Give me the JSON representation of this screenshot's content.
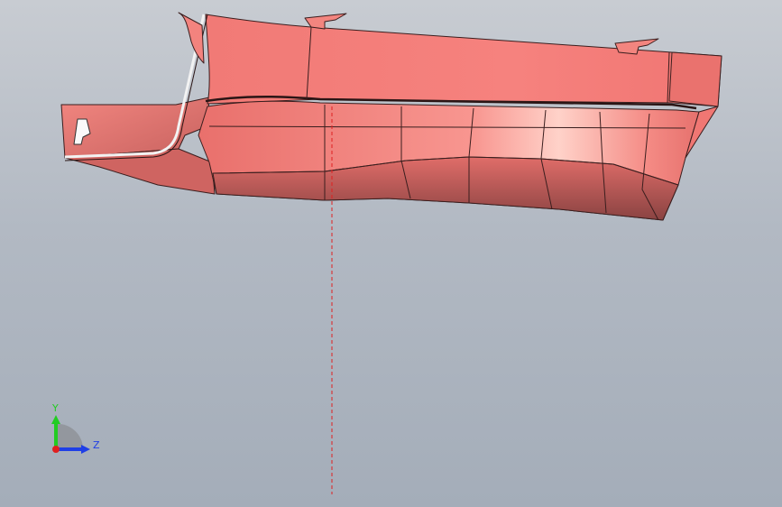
{
  "viewport": {
    "background_top": "#c8ccd2",
    "background_bottom": "#a4adb9",
    "model": {
      "name": "molded-part",
      "face_color": "#f27c78",
      "shade_color": "#b55a58",
      "edge_color": "#3a1e1e"
    },
    "section_line_color": "#e02020"
  },
  "triad": {
    "y_label": "Y",
    "z_label": "Z",
    "y_color": "#22cc22",
    "z_color": "#1f3fe6",
    "x_color": "#e02020"
  }
}
